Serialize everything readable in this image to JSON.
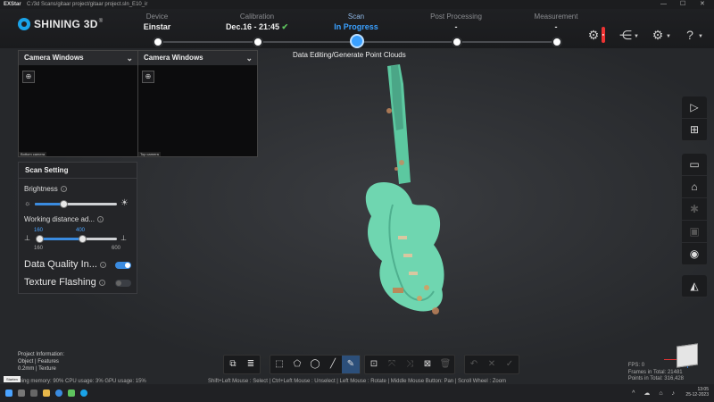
{
  "window": {
    "app_name": "EXStar",
    "path": "C:/3d Scans/gitaar project/gitaar project.sln_E10_ir"
  },
  "brand": {
    "logo_text": "SHINING 3D",
    "trademark": "®"
  },
  "steps": [
    {
      "label": "Device",
      "value": "Einstar"
    },
    {
      "label": "Calibration",
      "value": "Dec.16 - 21:45",
      "check": "✔"
    },
    {
      "label": "Scan",
      "value": "In Progress"
    },
    {
      "label": "Post Processing",
      "value": "-"
    },
    {
      "label": "Measurement",
      "value": "-"
    }
  ],
  "stage_title": "Data Editing/Generate Point Clouds",
  "camera_windows": [
    {
      "title": "Camera Windows",
      "caption": "Bottom camera"
    },
    {
      "title": "Camera Windows",
      "caption": "Top camera"
    }
  ],
  "scan_setting": {
    "title": "Scan Setting",
    "brightness": {
      "label": "Brightness",
      "level": 0.35
    },
    "working_distance": {
      "label": "Working distance ad...",
      "low_value": "160",
      "high_value": "400",
      "min_label": "160",
      "max_label": "600"
    },
    "data_quality": {
      "label": "Data Quality In...",
      "enabled": true
    },
    "texture_flashing": {
      "label": "Texture Flashing",
      "enabled": false
    }
  },
  "project_info": {
    "title": "Project Information:",
    "line1": "Object | Features",
    "line2": "0.2mm | Texture"
  },
  "status": {
    "memory": "ining memory: 90% CPU usage: 3%  GPU usage: 15%",
    "hint": "Shift+Left Mouse : Select | Ctrl+Left Mouse : Unselect | Left Mouse : Rotate | Middle Mouse Button: Pan | Scroll Wheel : Zoom"
  },
  "stats": {
    "fps": "FPS: 0",
    "frames": "Frames in Total: 21481",
    "points": "Points in Total: 316,428"
  },
  "taskbar": {
    "start_tooltip": "Starten",
    "time": "13:05",
    "date": "25-12-2023"
  },
  "colors": {
    "accent": "#3aa0ff",
    "guitar": "#6fd6b0"
  }
}
